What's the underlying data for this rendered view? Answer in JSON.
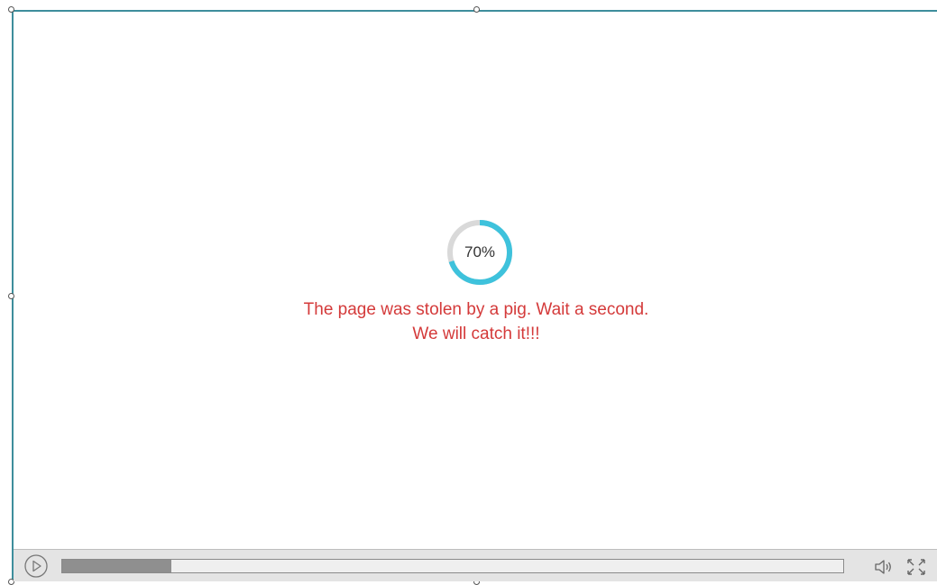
{
  "loader": {
    "percent_label": "70%",
    "progress": 0.7,
    "ring_color": "#3ec2dc",
    "track_color": "#d9d9d9"
  },
  "message": {
    "line1": "The page was stolen by a pig.  Wait a second.",
    "line2": "We will catch it!!!",
    "color": "#d43a3a"
  },
  "player": {
    "play_icon": "play-icon",
    "volume_icon": "volume-icon",
    "fullscreen_icon": "fullscreen-icon",
    "playback_progress": 0.14
  },
  "frame": {
    "border_color": "#3e8e9c"
  }
}
